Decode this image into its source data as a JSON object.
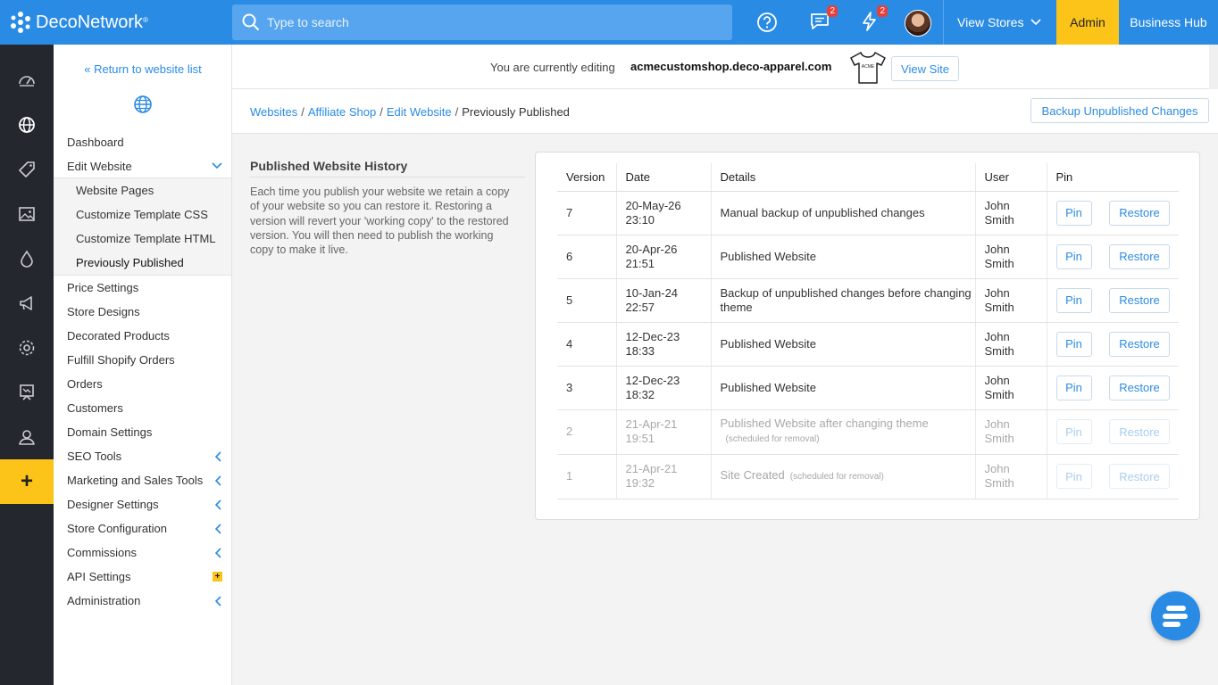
{
  "app": {
    "brand": "DecoNetwork",
    "brand_mark": "®",
    "search_placeholder": "Type to search",
    "messages_count": "2",
    "alerts_count": "2",
    "view_stores": "View Stores",
    "admin": "Admin",
    "business_hub": "Business Hub",
    "accent": "#2a8be4",
    "highlight": "#fcc419"
  },
  "rail": {
    "icons": [
      "dashboard-icon",
      "globe-icon",
      "tag-icon",
      "image-icon",
      "drop-icon",
      "megaphone-icon",
      "gear-icon",
      "easel-icon",
      "user-icon"
    ],
    "add_label": "+"
  },
  "sidebar": {
    "back_link": "« Return to website list",
    "items": [
      {
        "label": "Dashboard"
      },
      {
        "label": "Edit Website"
      },
      {
        "label": "Price Settings"
      },
      {
        "label": "Store Designs"
      },
      {
        "label": "Decorated Products"
      },
      {
        "label": "Fulfill Shopify Orders"
      },
      {
        "label": "Orders"
      },
      {
        "label": "Customers"
      },
      {
        "label": "Domain Settings"
      },
      {
        "label": "SEO Tools"
      },
      {
        "label": "Marketing and Sales Tools"
      },
      {
        "label": "Designer Settings"
      },
      {
        "label": "Store Configuration"
      },
      {
        "label": "Commissions"
      },
      {
        "label": "API Settings"
      },
      {
        "label": "Administration"
      }
    ],
    "subitems": [
      {
        "label": "Website Pages"
      },
      {
        "label": "Customize Template CSS"
      },
      {
        "label": "Customize Template HTML"
      },
      {
        "label": "Previously Published"
      }
    ],
    "api_badge": "+"
  },
  "editing": {
    "label": "You are currently editing",
    "domain": "acmecustomshop.deco-apparel.com",
    "shirt_text": "ACME",
    "view_site": "View Site"
  },
  "breadcrumb": {
    "websites": "Websites",
    "affiliate": "Affiliate Shop",
    "edit": "Edit Website",
    "current": "Previously Published",
    "sep": "/"
  },
  "backup_button": "Backup Unpublished Changes",
  "history": {
    "title": "Published Website History",
    "description": "Each time you publish your website we retain a copy of your website so you can restore it. Restoring a version will revert your 'working copy' to the restored version. You will then need to publish the working copy to make it live.",
    "columns": [
      "Version",
      "Date",
      "Details",
      "User",
      "Pin"
    ],
    "pin_label": "Pin",
    "restore_label": "Restore",
    "scheduled_note": "(scheduled for removal)",
    "rows": [
      {
        "version": "7",
        "date1": "20-May-26",
        "date2": "23:10",
        "details": "Manual backup of unpublished changes",
        "user1": "John",
        "user2": "Smith"
      },
      {
        "version": "6",
        "date1": "20-Apr-26",
        "date2": "21:51",
        "details": "Published Website",
        "user1": "John",
        "user2": "Smith"
      },
      {
        "version": "5",
        "date1": "10-Jan-24",
        "date2": "22:57",
        "details": "Backup of unpublished changes before changing theme",
        "user1": "John",
        "user2": "Smith"
      },
      {
        "version": "4",
        "date1": "12-Dec-23",
        "date2": "18:33",
        "details": "Published Website",
        "user1": "John",
        "user2": "Smith"
      },
      {
        "version": "3",
        "date1": "12-Dec-23",
        "date2": "18:32",
        "details": "Published Website",
        "user1": "John",
        "user2": "Smith"
      },
      {
        "version": "2",
        "date1": "21-Apr-21",
        "date2": "19:51",
        "details": "Published Website after changing theme",
        "user1": "John",
        "user2": "Smith"
      },
      {
        "version": "1",
        "date1": "21-Apr-21",
        "date2": "19:32",
        "details": "Site Created",
        "user1": "John",
        "user2": "Smith"
      }
    ]
  }
}
